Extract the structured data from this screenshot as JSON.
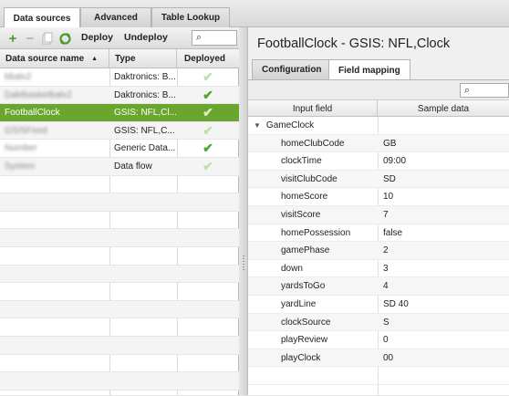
{
  "top_tabs": [
    {
      "label": "Data sources",
      "active": true
    },
    {
      "label": "Advanced",
      "active": false
    },
    {
      "label": "Table Lookup",
      "active": false
    }
  ],
  "left_toolbar": {
    "add_icon": "plus-icon",
    "remove_icon": "minus-icon",
    "copy_icon": "copy-icon",
    "refresh_icon": "refresh-icon",
    "deploy_label": "Deploy",
    "undeploy_label": "Undeploy",
    "search_value": ""
  },
  "data_sources": {
    "columns": [
      "Data source name",
      "Type",
      "Deployed"
    ],
    "sort_indicator": "▲",
    "rows": [
      {
        "name": "bbalv2",
        "type": "Daktronics: B...",
        "deployed": "faint",
        "blurred": true
      },
      {
        "name": "Daktbasketbalv2",
        "type": "Daktronics: B...",
        "deployed": "green",
        "blurred": true
      },
      {
        "name": "FootballClock",
        "type": "GSIS: NFL,Cl...",
        "deployed": "faint",
        "selected": true
      },
      {
        "name": "GSISFeed",
        "type": "GSIS: NFL,C...",
        "deployed": "faint",
        "blurred": true
      },
      {
        "name": "Number",
        "type": "Generic Data...",
        "deployed": "green",
        "blurred": true
      },
      {
        "name": "System",
        "type": "Data flow",
        "deployed": "faint",
        "blurred": true
      }
    ]
  },
  "detail": {
    "title": "FootballClock - GSIS: NFL,Clock",
    "tabs": [
      {
        "label": "Configuration",
        "active": false
      },
      {
        "label": "Field mapping",
        "active": true
      }
    ],
    "filter_value": "",
    "columns": [
      "Input field",
      "Sample data"
    ],
    "group": "GameClock",
    "fields": [
      {
        "field": "homeClubCode",
        "sample": "GB"
      },
      {
        "field": "clockTime",
        "sample": "09:00"
      },
      {
        "field": "visitClubCode",
        "sample": "SD"
      },
      {
        "field": "homeScore",
        "sample": "10"
      },
      {
        "field": "visitScore",
        "sample": "7"
      },
      {
        "field": "homePossession",
        "sample": "false"
      },
      {
        "field": "gamePhase",
        "sample": "2"
      },
      {
        "field": "down",
        "sample": "3"
      },
      {
        "field": "yardsToGo",
        "sample": "4"
      },
      {
        "field": "yardLine",
        "sample": "SD 40"
      },
      {
        "field": "clockSource",
        "sample": "S"
      },
      {
        "field": "playReview",
        "sample": "0"
      },
      {
        "field": "playClock",
        "sample": "00"
      }
    ]
  },
  "colors": {
    "selection": "#6aa52e",
    "check_on": "#4fa52c",
    "check_off": "#bfe0ac"
  }
}
